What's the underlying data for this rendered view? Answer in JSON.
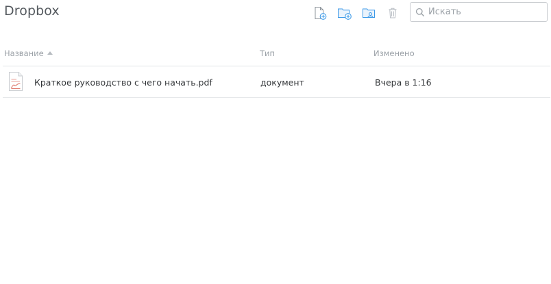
{
  "header": {
    "title": "Dropbox"
  },
  "toolbar": {
    "buttons": [
      {
        "icon": "new-file-icon"
      },
      {
        "icon": "new-folder-icon"
      },
      {
        "icon": "shared-folder-icon"
      },
      {
        "icon": "trash-icon"
      }
    ],
    "accent_color": "#3d9ae8",
    "disabled_color": "#b9bec4"
  },
  "search": {
    "placeholder": "Искать",
    "value": ""
  },
  "columns": {
    "name": "Название",
    "type": "Тип",
    "modified": "Изменено",
    "sort": "name-ascending"
  },
  "files": [
    {
      "name": "Краткое руководство с чего начать.pdf",
      "type": "документ",
      "modified": "Вчера в 1:16",
      "icon": "pdf-file-icon"
    }
  ]
}
